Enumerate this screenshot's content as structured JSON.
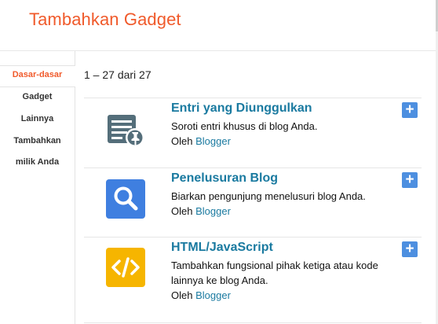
{
  "dialog": {
    "title": "Tambahkan Gadget"
  },
  "sidebar": {
    "items": [
      {
        "label": "Dasar-dasar",
        "active": true
      },
      {
        "label": "Gadget",
        "active": false
      },
      {
        "label": "Lainnya",
        "active": false
      },
      {
        "label": "Tambahkan",
        "active": false
      },
      {
        "label": "milik Anda",
        "active": false
      }
    ]
  },
  "results": {
    "count_text": "1 – 27 dari 27"
  },
  "gadgets": [
    {
      "name": "Entri yang Diunggulkan",
      "description": "Soroti entri khusus di blog Anda.",
      "by_label": "Oleh",
      "author": "Blogger",
      "icon": "featured-post-icon",
      "icon_color": "#546e7a"
    },
    {
      "name": "Penelusuran Blog",
      "description": "Biarkan pengunjung menelusuri blog Anda.",
      "by_label": "Oleh",
      "author": "Blogger",
      "icon": "search-icon",
      "icon_color": "#3f7fe0"
    },
    {
      "name": "HTML/JavaScript",
      "description": "Tambahkan fungsional pihak ketiga atau kode lainnya ke blog Anda.",
      "by_label": "Oleh",
      "author": "Blogger",
      "icon": "code-icon",
      "icon_color": "#f6b500"
    }
  ],
  "add_button": {
    "label": "+"
  },
  "colors": {
    "accent": "#f05a2b",
    "link": "#1a7aa0",
    "add_button": "#4d8fe0"
  }
}
